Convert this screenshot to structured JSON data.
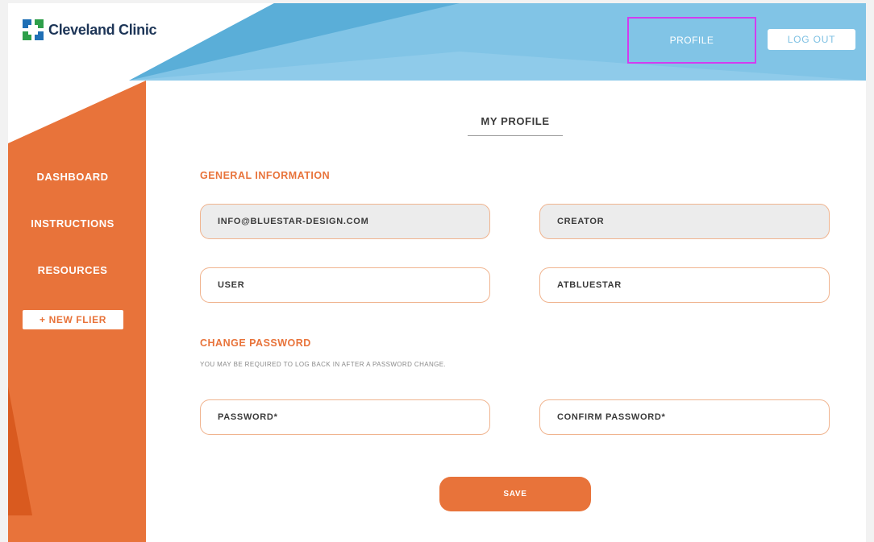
{
  "brand": {
    "name": "Cleveland Clinic"
  },
  "header": {
    "profile_label": "PROFILE",
    "logout_label": "LOG OUT"
  },
  "sidebar": {
    "items": [
      {
        "label": "DASHBOARD"
      },
      {
        "label": "INSTRUCTIONS"
      },
      {
        "label": "RESOURCES"
      }
    ],
    "new_flier_label": "+ NEW FLIER"
  },
  "main": {
    "title": "MY PROFILE",
    "general": {
      "heading": "GENERAL INFORMATION",
      "email_value": "INFO@BLUESTAR-DESIGN.COM",
      "role_value": "CREATOR",
      "first_name_value": "USER",
      "last_name_value": "ATBLUESTAR"
    },
    "password": {
      "heading": "CHANGE PASSWORD",
      "note": "YOU MAY BE REQUIRED TO LOG BACK IN AFTER A PASSWORD CHANGE.",
      "password_placeholder": "PASSWORD*",
      "confirm_placeholder": "CONFIRM PASSWORD*"
    },
    "save_label": "SAVE"
  },
  "colors": {
    "orange": "#e8733a",
    "blue": "#7fc1e3",
    "dark_blue": "#1d3557",
    "highlight": "#d33cf0"
  }
}
